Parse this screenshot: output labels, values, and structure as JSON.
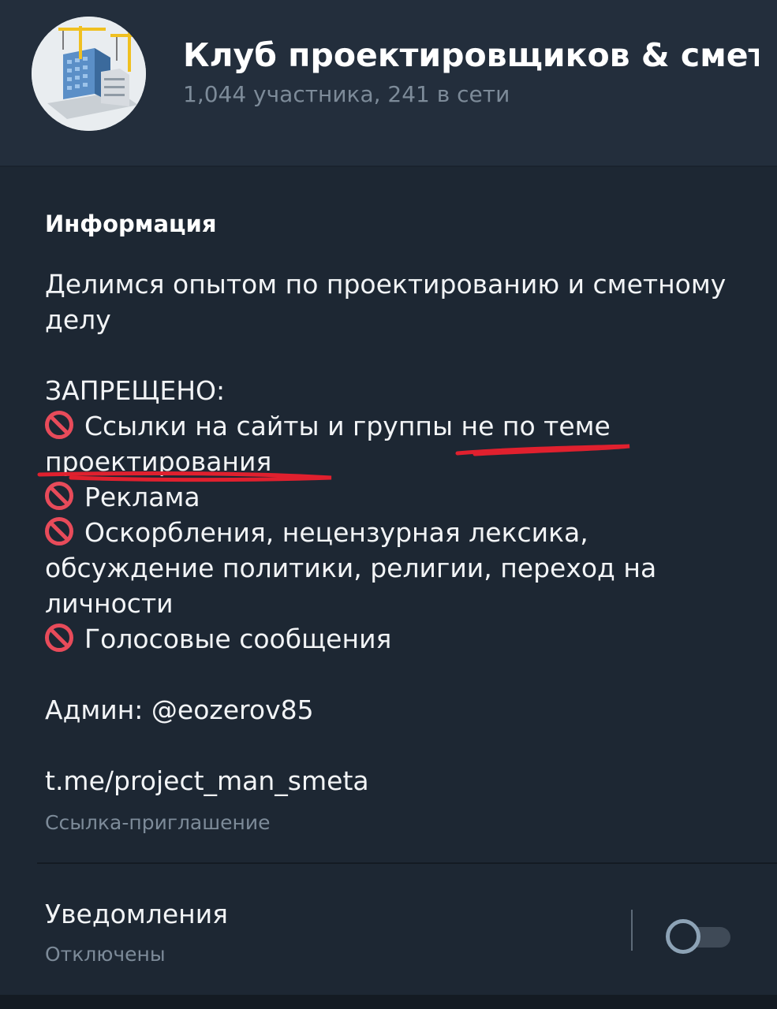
{
  "header": {
    "title": "Клуб проектировщиков & сметч",
    "members": "1,044 участника, 241 в сети"
  },
  "info": {
    "heading": "Информация",
    "description_line1": "Делимся опытом по проектированию и сметному",
    "description_line2": "делу",
    "forbidden_title": "ЗАПРЕЩЕНО:",
    "rule1_line1": "Ссылки на сайты и группы не по теме",
    "rule1_line2": "проектирования",
    "rule2": "Реклама",
    "rule3_line1": "Оскорбления, нецензурная лексика,",
    "rule3_line2": "обсуждение политики, религии, переход на",
    "rule3_line3": "личности",
    "rule4": "Голосовые сообщения",
    "admin": "Админ: @eozerov85",
    "invite_link": "t.me/project_man_smeta",
    "invite_caption": "Ссылка-приглашение"
  },
  "notifications": {
    "title": "Уведомления",
    "status": "Отключены",
    "enabled": false
  },
  "icons": {
    "rule_icon": "no-entry-icon"
  },
  "colors": {
    "background": "#1d2733",
    "header_background": "#232e3c",
    "secondary_text": "#7d8b99",
    "no_entry": "#e84b5a",
    "annotation": "#e0202e"
  }
}
